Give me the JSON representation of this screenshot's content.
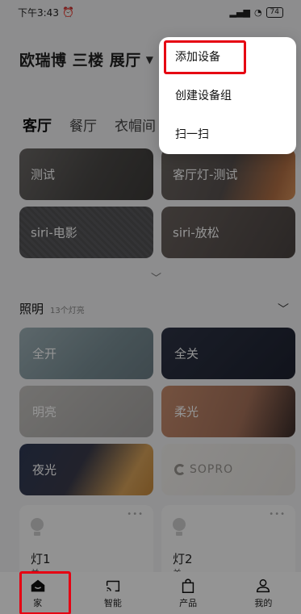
{
  "status_bar": {
    "time": "下午3:43",
    "alarm_icon": "alarm-clock-icon",
    "signal": "ᴴᴰ",
    "battery": "74"
  },
  "header": {
    "home_title": "欧瑞博 三楼 展厅"
  },
  "rooms": [
    {
      "label": "客厅",
      "active": true
    },
    {
      "label": "餐厅",
      "active": false
    },
    {
      "label": "衣帽间",
      "active": false
    }
  ],
  "scenes": [
    {
      "label": "测试"
    },
    {
      "label": "客厅灯-测试"
    },
    {
      "label": "siri-电影"
    },
    {
      "label": "siri-放松"
    }
  ],
  "lighting": {
    "title": "照明",
    "subtitle": "13个灯亮",
    "scenes": [
      {
        "label": "全开"
      },
      {
        "label": "全关"
      },
      {
        "label": "明亮"
      },
      {
        "label": "柔光"
      },
      {
        "label": "夜光"
      },
      {
        "label": "SOPRO"
      }
    ]
  },
  "devices": [
    {
      "name": "灯1",
      "state": "关",
      "more": "•••"
    },
    {
      "name": "灯2",
      "state": "关",
      "more": "•••"
    }
  ],
  "menu": {
    "items": [
      {
        "label": "添加设备"
      },
      {
        "label": "创建设备组"
      },
      {
        "label": "扫一扫"
      }
    ]
  },
  "bottom_nav": [
    {
      "label": "家",
      "icon": "home-icon"
    },
    {
      "label": "智能",
      "icon": "smart-icon"
    },
    {
      "label": "产品",
      "icon": "shopping-bag-icon"
    },
    {
      "label": "我的",
      "icon": "profile-icon"
    }
  ],
  "colors": {
    "highlight": "#e60012",
    "overlay": "rgba(0,0,0,0.42)"
  }
}
